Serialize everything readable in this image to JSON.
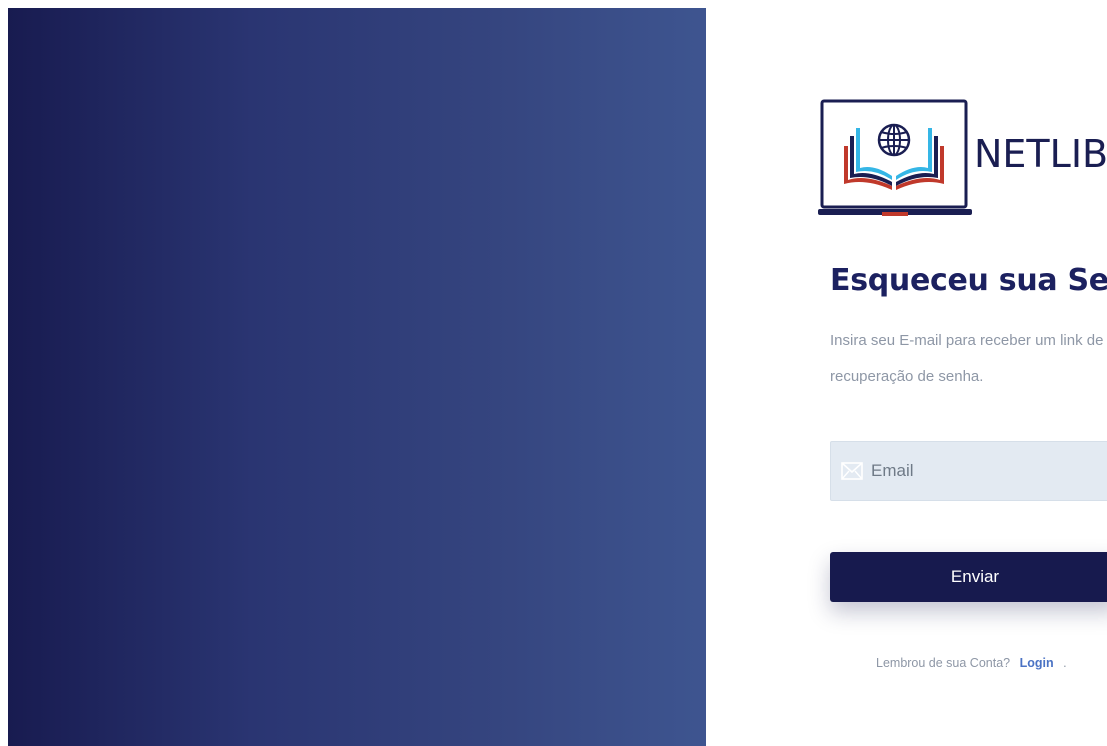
{
  "brand": {
    "name": "NETLIB",
    "logo_icon": "laptop-open-book-globe-icon"
  },
  "form": {
    "title": "Esqueceu sua Senha?",
    "description_line1": "Insira seu E-mail para receber um link de",
    "description_line2": "recuperação de senha.",
    "email_icon": "envelope-icon",
    "email_placeholder": "Email",
    "email_value": "",
    "submit_label": "Enviar"
  },
  "footer": {
    "prompt": "Lembrou de sua Conta?",
    "login_label": "Login",
    "trailing": "."
  },
  "colors": {
    "gradient_start": "#181b50",
    "gradient_end": "#3e5590",
    "primary": "#171a4e",
    "link": "#4a72c4",
    "muted_text": "#8e97a6",
    "input_bg": "#e3eaf2"
  }
}
